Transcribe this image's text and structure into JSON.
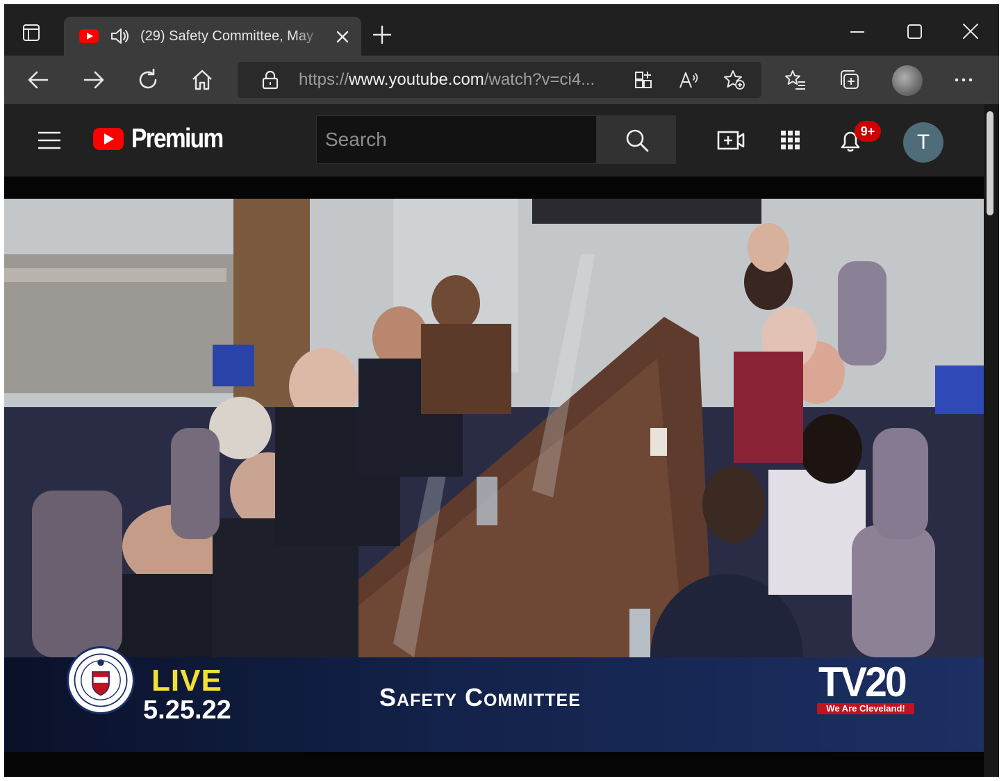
{
  "browser": {
    "tab": {
      "title": "(29) Safety Committee, May"
    },
    "address": {
      "url_scheme": "https://",
      "url_host": "www.youtube.com",
      "url_path": "/watch?v=ci4..."
    }
  },
  "youtube": {
    "brand": "Premium",
    "search": {
      "placeholder": "Search"
    },
    "notifications": {
      "badge": "9+"
    },
    "avatar_letter": "T"
  },
  "video": {
    "overlay": {
      "live": "LIVE",
      "date": "5.25.22",
      "title": "Safety Committee",
      "station": "TV20",
      "tagline": "We Are Cleveland!"
    }
  },
  "colors": {
    "live_yellow": "#f2e034",
    "brand_red": "#ff0000",
    "badge_red": "#cc0000",
    "avatar_bg": "#4e6d78",
    "overlay_blue": "#13224a"
  }
}
